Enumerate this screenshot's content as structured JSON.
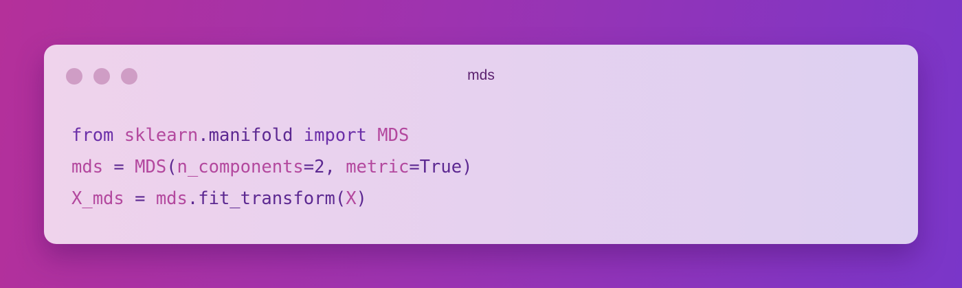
{
  "window": {
    "title": "mds",
    "controls": [
      "close-dot",
      "minimize-dot",
      "maximize-dot"
    ]
  },
  "code": {
    "lines": [
      [
        {
          "t": "from",
          "c": "kw"
        },
        {
          "t": " ",
          "c": "op"
        },
        {
          "t": "sklearn",
          "c": "pk"
        },
        {
          "t": ".manifold ",
          "c": "op"
        },
        {
          "t": "import",
          "c": "kw"
        },
        {
          "t": " ",
          "c": "op"
        },
        {
          "t": "MDS",
          "c": "pk"
        }
      ],
      [
        {
          "t": "mds",
          "c": "pk"
        },
        {
          "t": " = ",
          "c": "op"
        },
        {
          "t": "MDS",
          "c": "pk"
        },
        {
          "t": "(",
          "c": "op"
        },
        {
          "t": "n_components",
          "c": "pk"
        },
        {
          "t": "=2, ",
          "c": "op"
        },
        {
          "t": "metric",
          "c": "pk"
        },
        {
          "t": "=True)",
          "c": "op"
        }
      ],
      [
        {
          "t": "X_mds",
          "c": "pk"
        },
        {
          "t": " = ",
          "c": "op"
        },
        {
          "t": "mds",
          "c": "pk"
        },
        {
          "t": ".fit_transform(",
          "c": "op"
        },
        {
          "t": "X",
          "c": "pk"
        },
        {
          "t": ")",
          "c": "op"
        }
      ]
    ]
  }
}
